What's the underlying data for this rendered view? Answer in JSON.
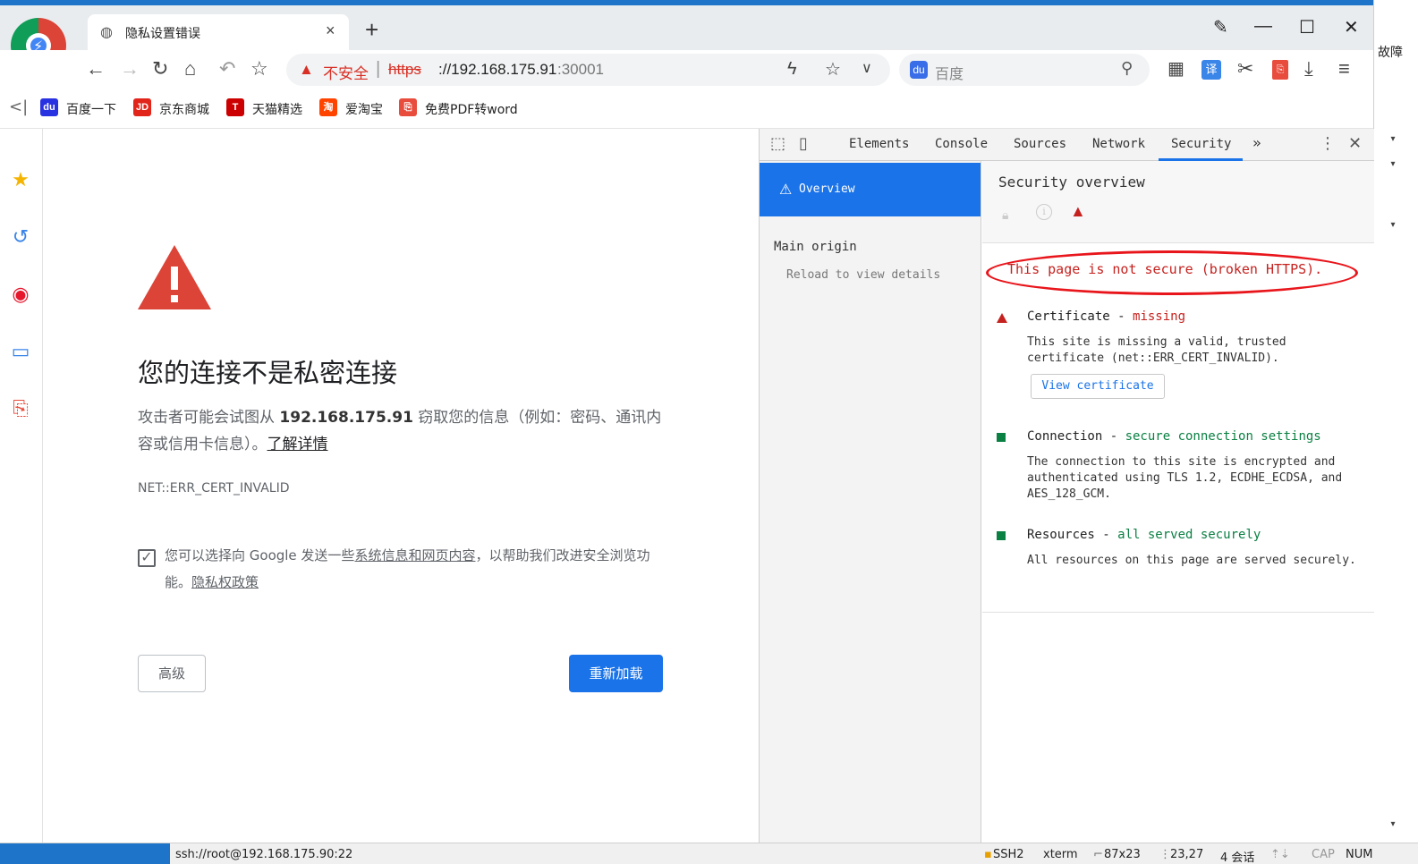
{
  "window": {
    "tab_title": "隐私设置错误",
    "tab_close": "×",
    "new_tab": "+",
    "controls": [
      "✎",
      "—",
      "☐",
      "✕"
    ]
  },
  "toolbar": {
    "insecure_label": "不安全",
    "url_scheme": "https",
    "url_host": "://192.168.175.91",
    "url_port": ":30001",
    "search_placeholder": "百度"
  },
  "bookmarks": [
    {
      "label": "百度一下",
      "icon": "baidu-icon",
      "color": "#2932e1"
    },
    {
      "label": "京东商城",
      "icon": "jd-icon",
      "color": "#e1251b"
    },
    {
      "label": "天猫精选",
      "icon": "tmall-icon",
      "color": "#cc0000"
    },
    {
      "label": "爱淘宝",
      "icon": "taobao-icon",
      "color": "#ff4400"
    },
    {
      "label": "免费PDF转word",
      "icon": "pdf-icon",
      "color": "#e84c3d"
    }
  ],
  "sidebar": [
    "star-icon",
    "history-icon",
    "weibo-icon",
    "card-icon",
    "pdf-icon"
  ],
  "error_page": {
    "title": "您的连接不是私密连接",
    "desc_before": "攻击者可能会试图从 ",
    "desc_host": "192.168.175.91",
    "desc_after": " 窃取您的信息（例如：密码、通讯内容或信用卡信息）。",
    "learn_more": "了解详情",
    "error_code": "NET::ERR_CERT_INVALID",
    "opt_in_before": "您可以选择向 Google 发送一些",
    "opt_in_link": "系统信息和网页内容",
    "opt_in_after": "，以帮助我们改进安全浏览功能。",
    "privacy_link": "隐私权政策",
    "advanced_button": "高级",
    "reload_button": "重新加载",
    "checkbox_checked": true,
    "accent": "#1a73e8",
    "warning_color": "#db4437"
  },
  "devtools": {
    "tabs": [
      "Elements",
      "Console",
      "Sources",
      "Network",
      "Security"
    ],
    "active_tab": "Security",
    "more": "»",
    "overview_label": "Overview",
    "main_origin": "Main origin",
    "reload_details": "Reload to view details",
    "security_overview_title": "Security overview",
    "summary": "This page is not secure (broken HTTPS).",
    "certificate": {
      "label": "Certificate - ",
      "status": "missing",
      "desc": "This site is missing a valid, trusted certificate (net::ERR_CERT_INVALID).",
      "button": "View certificate"
    },
    "connection": {
      "label": "Connection - ",
      "status": "secure connection settings",
      "desc": "The connection to this site is encrypted and authenticated using TLS 1.2, ECDHE_ECDSA, and AES_128_GCM."
    },
    "resources": {
      "label": "Resources - ",
      "status": "all served securely",
      "desc": "All resources on this page are served securely."
    }
  },
  "desktop": {
    "side_text": "故障"
  },
  "statusbar": {
    "ssh_target": "ssh://root@192.168.175.90:22",
    "protocol": "SSH2",
    "term": "xterm",
    "size": "87x23",
    "cursor": "23,27",
    "sessions": "4 会话",
    "cap": "CAP",
    "num": "NUM"
  }
}
